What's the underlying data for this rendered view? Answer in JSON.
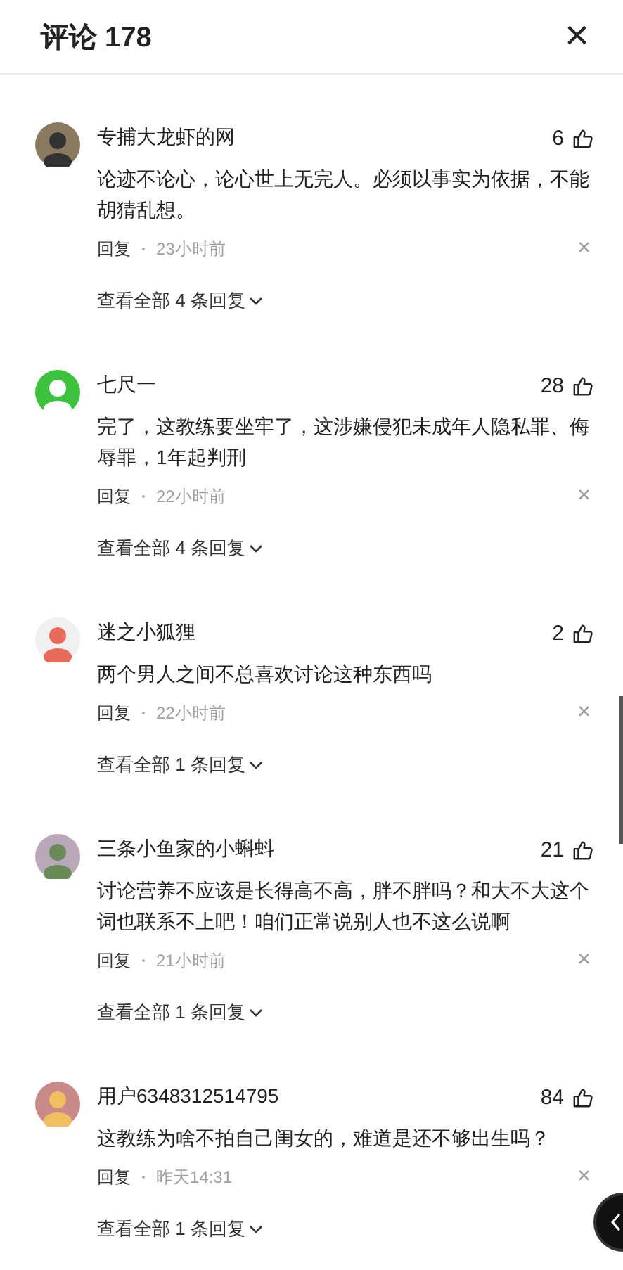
{
  "header": {
    "title": "评论 178",
    "close": "×"
  },
  "comments": [
    {
      "user": "专捕大龙虾的网",
      "likes": "6",
      "text": "论迹不论心，论心世上无完人。必须以事实为依据，不能胡猜乱想。",
      "reply": "回复",
      "time": "23小时前",
      "dismiss": "×",
      "more": "查看全部 4 条回复"
    },
    {
      "user": "七尺一",
      "likes": "28",
      "text": "完了，这教练要坐牢了，这涉嫌侵犯未成年人隐私罪、侮辱罪，1年起判刑",
      "reply": "回复",
      "time": "22小时前",
      "dismiss": "×",
      "more": "查看全部 4 条回复"
    },
    {
      "user": "迷之小狐狸",
      "likes": "2",
      "text": "两个男人之间不总喜欢讨论这种东西吗",
      "reply": "回复",
      "time": "22小时前",
      "dismiss": "×",
      "more": "查看全部 1 条回复"
    },
    {
      "user": "三条小鱼家的小蝌蚪",
      "likes": "21",
      "text": "讨论营养不应该是长得高不高，胖不胖吗？和大不大这个词也联系不上吧！咱们正常说别人也不这么说啊",
      "reply": "回复",
      "time": "21小时前",
      "dismiss": "×",
      "more": "查看全部 1 条回复"
    },
    {
      "user": "用户6348312514795",
      "likes": "84",
      "text": "这教练为啥不拍自己闺女的，难道是还不够出生吗？",
      "reply": "回复",
      "time": "昨天14:31",
      "dismiss": "×",
      "more": "查看全部 1 条回复"
    }
  ]
}
